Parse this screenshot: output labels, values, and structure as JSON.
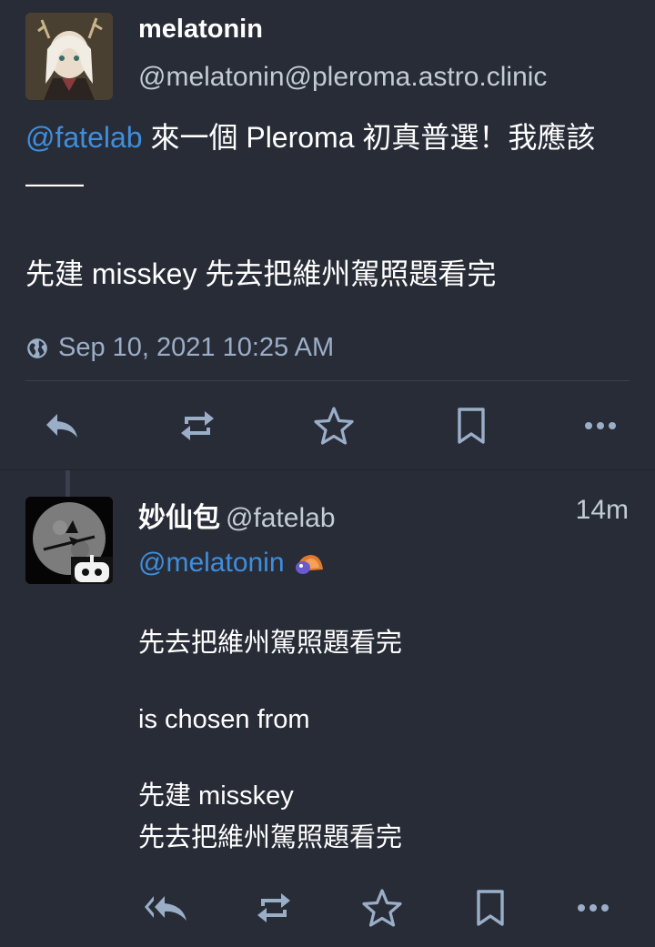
{
  "status": {
    "display_name": "melatonin",
    "acct": "@melatonin@pleroma.astro.clinic",
    "mention": "@fatelab",
    "line1_rest": " 來一個 Pleroma 初真普選！我應該——",
    "line2": "先建 misskey 先去把維州駕照題看完",
    "timestamp": "Sep 10, 2021 10:25 AM",
    "actions": [
      "reply-icon",
      "boost-icon",
      "favourite-icon",
      "bookmark-icon",
      "more-icon"
    ]
  },
  "reply": {
    "display_name": "妙仙包",
    "acct": "@fatelab",
    "time": "14m",
    "mention": "@melatonin",
    "para1": "先去把維州駕照題看完",
    "para2": "is chosen from",
    "para3_line1": "先建 misskey",
    "para3_line2": "先去把維州駕照題看完",
    "actions": [
      "reply-all-icon",
      "boost-icon",
      "favourite-icon",
      "bookmark-icon",
      "more-icon"
    ]
  },
  "colors": {
    "background": "#282c37",
    "accent": "#3f8edd",
    "muted": "#9baec8",
    "text": "#ffffff"
  }
}
